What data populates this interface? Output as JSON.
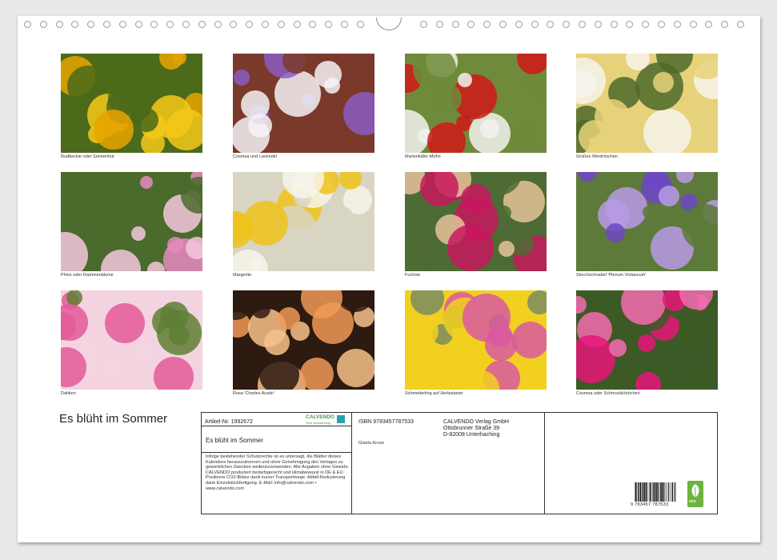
{
  "calendar": {
    "title": "Es blüht im Sommer",
    "photos": [
      {
        "caption": "Rudbeckie oder Sonnenhut",
        "colors": [
          "#e8a300",
          "#f6c818",
          "#4b6a1a"
        ]
      },
      {
        "caption": "Cosmea und Lavendel",
        "colors": [
          "#8b5cc2",
          "#f4f2f6",
          "#7a3a2a"
        ]
      },
      {
        "caption": "Marienkäfer-Mohn",
        "colors": [
          "#d01818",
          "#f2f2ee",
          "#6f8a3a"
        ]
      },
      {
        "caption": "Großes Windröschen",
        "colors": [
          "#f6f4ec",
          "#4c6a2a",
          "#e6d27a"
        ]
      },
      {
        "caption": "Phlox oder Flammenblume",
        "colors": [
          "#e58ac0",
          "#f5c7de",
          "#4a6b2b"
        ]
      },
      {
        "caption": "Margerite",
        "colors": [
          "#f7f5ea",
          "#f0c21a",
          "#d8d5c3"
        ]
      },
      {
        "caption": "Fuchsie",
        "colors": [
          "#e6c39a",
          "#c8175e",
          "#4d6b34"
        ]
      },
      {
        "caption": "Storchschnabel 'Plenum Violaceum'",
        "colors": [
          "#6f47c6",
          "#b79be6",
          "#5d7a3a"
        ]
      },
      {
        "caption": "Dahlien",
        "colors": [
          "#5f7f35",
          "#e25b98",
          "#f3d3e0"
        ]
      },
      {
        "caption": "Rosa 'Charles Austin'",
        "colors": [
          "#f19a56",
          "#f7c28a",
          "#2d1a10"
        ]
      },
      {
        "caption": "Schmetterling auf Herbstaster",
        "colors": [
          "#7c8c62",
          "#d85aa0",
          "#f1d020"
        ]
      },
      {
        "caption": "Cosmea oder Schmuckkörbchen",
        "colors": [
          "#e8157a",
          "#f56bb0",
          "#3c5a25"
        ]
      }
    ]
  },
  "info": {
    "article_no": "Artikel-Nr. 1992672",
    "brand": "CALVENDO",
    "brand_sub": "Sehr Auswahlung",
    "title": "Es blüht im Sommer",
    "legal": "Infolge bestehender Schutzrechte ist es untersagt, die Blätter dieses Kalenders herauszutrennen und ohne Genehmigung des Verlages zu gewerblichen Zwecken weiterzuverwenden. Alle Angaben ohne Gewähr. CALVENDO produziert bedarfsgerecht und klimabewusst in DE & EU. Positivere CO2-Bilanz dank kurzer Transportwege. Abfall-Reduzierung dank Einzelstückfertigung. E-Mail: info@calvendo.com • www.calvendo.com",
    "isbn": "ISBN 9783457787533",
    "author": "Gisela Kruse",
    "publisher_name": "CALVENDO Verlag GmbH",
    "publisher_street": "Ottobrunner Straße 39",
    "publisher_city": "D-82008 Unterhaching",
    "barcode_digits": "9 783457 787533",
    "eco_label": "eco"
  }
}
